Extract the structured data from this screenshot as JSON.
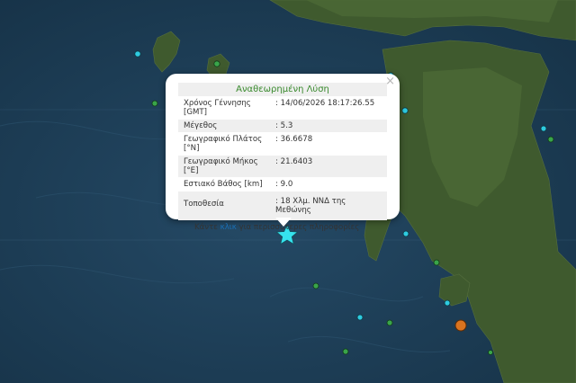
{
  "popup": {
    "title": "Αναθεωρημένη Λύση",
    "close_label": "×",
    "rows": [
      {
        "label": "Χρόνος Γέννησης [GMT]",
        "value": "14/06/2026 18:17:26.55"
      },
      {
        "label": "Μέγεθος",
        "value": "5.3"
      },
      {
        "label": "Γεωγραφικό Πλάτος [°N]",
        "value": "36.6678"
      },
      {
        "label": "Γεωγραφικό Μήκος [°E]",
        "value": "21.6403"
      },
      {
        "label": "Εστιακό Βάθος [km]",
        "value": "9.0"
      },
      {
        "label": "Τοποθεσία",
        "value": "18 Χλμ. ΝΝΔ της Μεθώνης"
      }
    ],
    "more_prefix": "Κάντε ",
    "more_link": "κλικ",
    "more_suffix": " για περισσότερες πληροφορίες"
  },
  "colors": {
    "sea": "#1d3b52",
    "land": "#3f5a2e",
    "recent_marker": "#2ecbe0",
    "older_marker": "#3aa54a",
    "strong_marker": "#d9731f",
    "popup_title": "#3a8a2e",
    "link": "#1a6fb5"
  },
  "map": {
    "selected_event_icon": "star-marker-icon",
    "marker_legend_icons": [
      "cyan-circle-marker-icon",
      "green-circle-marker-icon",
      "orange-circle-marker-icon"
    ]
  }
}
